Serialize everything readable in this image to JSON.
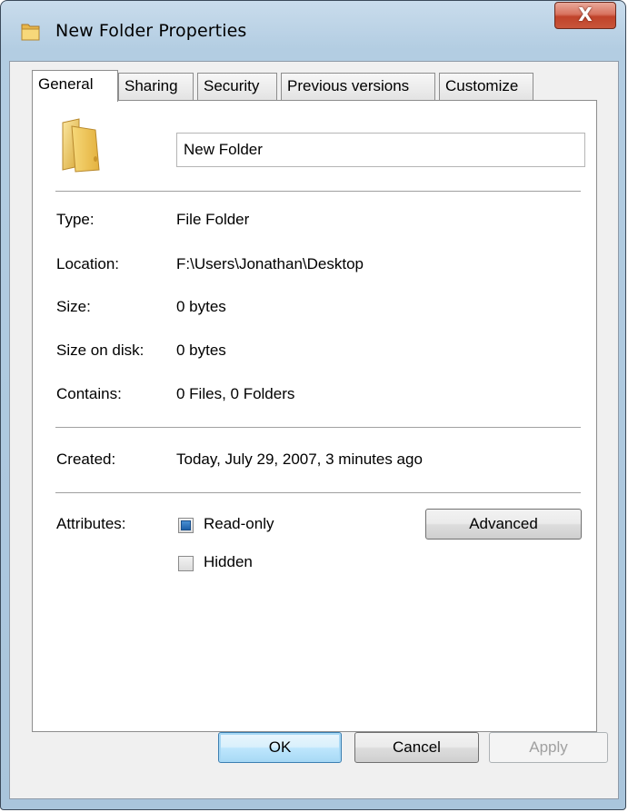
{
  "window": {
    "title": "New Folder Properties",
    "close_label": "X"
  },
  "tabs": [
    {
      "label": "General",
      "active": true
    },
    {
      "label": "Sharing",
      "active": false
    },
    {
      "label": "Security",
      "active": false
    },
    {
      "label": "Previous versions",
      "active": false
    },
    {
      "label": "Customize",
      "active": false
    }
  ],
  "general": {
    "folder_name": "New Folder",
    "type": {
      "label": "Type:",
      "value": "File Folder"
    },
    "location": {
      "label": "Location:",
      "value": "F:\\Users\\Jonathan\\Desktop"
    },
    "size": {
      "label": "Size:",
      "value": "0 bytes"
    },
    "size_on_disk": {
      "label": "Size on disk:",
      "value": "0 bytes"
    },
    "contains": {
      "label": "Contains:",
      "value": "0 Files, 0 Folders"
    },
    "created": {
      "label": "Created:",
      "value": "Today, July 29, 2007, 3 minutes ago"
    },
    "attributes": {
      "label": "Attributes:",
      "read_only": {
        "label": "Read-only",
        "checked": true,
        "state": "indeterminate"
      },
      "hidden": {
        "label": "Hidden",
        "checked": false
      },
      "advanced_label": "Advanced"
    }
  },
  "footer": {
    "ok_label": "OK",
    "cancel_label": "Cancel",
    "apply_label": "Apply",
    "apply_enabled": false
  },
  "icons": {
    "title": "folder-icon",
    "large": "folder-icon",
    "close": "close-icon"
  }
}
